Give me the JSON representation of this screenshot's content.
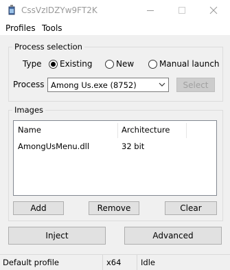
{
  "window": {
    "title": "CssVzIDZYw9FT2K"
  },
  "menu": {
    "items": [
      "Profiles",
      "Tools"
    ]
  },
  "process_selection": {
    "group_label": "Process selection",
    "type_label": "Type",
    "radios": [
      {
        "label": "Existing",
        "checked": true
      },
      {
        "label": "New",
        "checked": false
      },
      {
        "label": "Manual launch",
        "checked": false
      }
    ],
    "process_label": "Process",
    "process_value": "Among Us.exe (8752)",
    "select_button": "Select"
  },
  "images": {
    "group_label": "Images",
    "columns": [
      "Name",
      "Architecture"
    ],
    "rows": [
      {
        "name": "AmongUsMenu.dll",
        "arch": "32 bit"
      }
    ],
    "add_button": "Add",
    "remove_button": "Remove",
    "clear_button": "Clear"
  },
  "actions": {
    "inject": "Inject",
    "advanced": "Advanced"
  },
  "status": {
    "profile": "Default profile",
    "arch": "x64",
    "state": "Idle"
  }
}
